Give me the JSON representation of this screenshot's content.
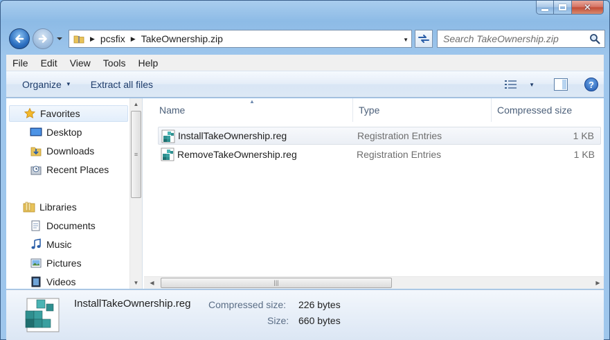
{
  "window": {
    "caption": {
      "minimize": "minimize",
      "maximize": "maximize",
      "close": "close"
    }
  },
  "nav": {
    "breadcrumbs": [
      "pcsfix",
      "TakeOwnership.zip"
    ],
    "search_placeholder": "Search TakeOwnership.zip"
  },
  "menu": [
    "File",
    "Edit",
    "View",
    "Tools",
    "Help"
  ],
  "toolbar": {
    "organize": "Organize",
    "extract": "Extract all files"
  },
  "sidebar": {
    "favorites": {
      "label": "Favorites",
      "items": [
        {
          "label": "Desktop",
          "icon": "desktop-icon"
        },
        {
          "label": "Downloads",
          "icon": "downloads-folder-icon"
        },
        {
          "label": "Recent Places",
          "icon": "recent-places-icon"
        }
      ]
    },
    "libraries": {
      "label": "Libraries",
      "items": [
        {
          "label": "Documents",
          "icon": "documents-icon"
        },
        {
          "label": "Music",
          "icon": "music-icon"
        },
        {
          "label": "Pictures",
          "icon": "pictures-icon"
        },
        {
          "label": "Videos",
          "icon": "videos-icon"
        }
      ]
    }
  },
  "columns": {
    "name": "Name",
    "type": "Type",
    "size": "Compressed size"
  },
  "files": [
    {
      "name": "InstallTakeOwnership.reg",
      "type": "Registration Entries",
      "size": "1 KB",
      "selected": true
    },
    {
      "name": "RemoveTakeOwnership.reg",
      "type": "Registration Entries",
      "size": "1 KB",
      "selected": false
    }
  ],
  "details": {
    "name": "InstallTakeOwnership.reg",
    "compressed_label": "Compressed size:",
    "compressed_value": "226 bytes",
    "size_label": "Size:",
    "size_value": "660 bytes"
  },
  "colors": {
    "frame": "#9ec6ec",
    "command_text": "#1e3c6a",
    "column_text": "#4c607a",
    "secondary_text": "#6d6d6d"
  }
}
